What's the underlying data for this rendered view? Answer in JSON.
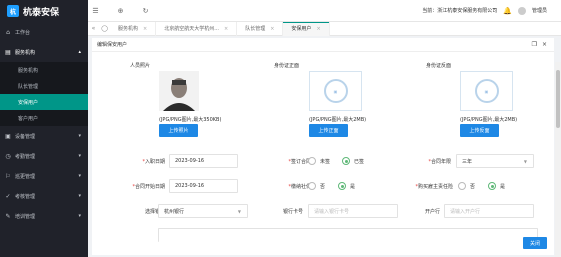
{
  "app": {
    "logo_text": "杭泰安保",
    "logo_badge": "杭"
  },
  "sidebar": {
    "items": [
      {
        "label": "工作台",
        "icon": "home-icon"
      },
      {
        "label": "服务机构",
        "icon": "building-icon",
        "open": true
      },
      {
        "label": "设备管理",
        "icon": "device-icon"
      },
      {
        "label": "考勤管理",
        "icon": "clock-icon"
      },
      {
        "label": "巡更管理",
        "icon": "patrol-icon"
      },
      {
        "label": "考核管理",
        "icon": "check-icon"
      },
      {
        "label": "培训管理",
        "icon": "training-icon"
      }
    ],
    "subitems": [
      {
        "label": "服务机构"
      },
      {
        "label": "队长管理"
      },
      {
        "label": "安保用户",
        "active": true
      },
      {
        "label": "客户用户"
      }
    ]
  },
  "topbar": {
    "current_label": "当前：浙江杭泰安保服务有限公司",
    "user": "管理员"
  },
  "tabs": [
    {
      "label": "服务机构"
    },
    {
      "label": "北京航空航天大学杭州..."
    },
    {
      "label": "队长管理"
    },
    {
      "label": "安保用户",
      "active": true
    }
  ],
  "panel": {
    "title": "编辑保安用户",
    "photos": [
      {
        "label": "人员照片",
        "hint": "(JPG/PNG图片,最大350KB)",
        "button": "上传照片"
      },
      {
        "label": "身份证正面",
        "hint": "(JPG/PNG图片,最大2MB)",
        "button": "上传正面"
      },
      {
        "label": "身份证反面",
        "hint": "(JPG/PNG图片,最大2MB)",
        "button": "上传反面"
      }
    ],
    "form": {
      "entry_date_label": "入职日期",
      "entry_date": "2023-09-16",
      "contract_signed_label": "签订合同",
      "contract_no": "未签",
      "contract_yes": "已签",
      "contract_term_label": "合同年限",
      "contract_term": "三年",
      "contract_start_label": "合同开始日期",
      "contract_start": "2023-09-16",
      "social_security_label": "缴纳社保",
      "ss_no": "否",
      "ss_yes": "是",
      "employer_insurance_label": "购买雇主责任险",
      "ei_no": "否",
      "ei_yes": "是",
      "bank_label": "选择银行",
      "bank": "杭州银行",
      "card_label": "银行卡号",
      "card_placeholder": "请输入银行卡号",
      "branch_label": "开户行",
      "branch_placeholder": "请输入开户行"
    },
    "close_button": "关闭"
  }
}
